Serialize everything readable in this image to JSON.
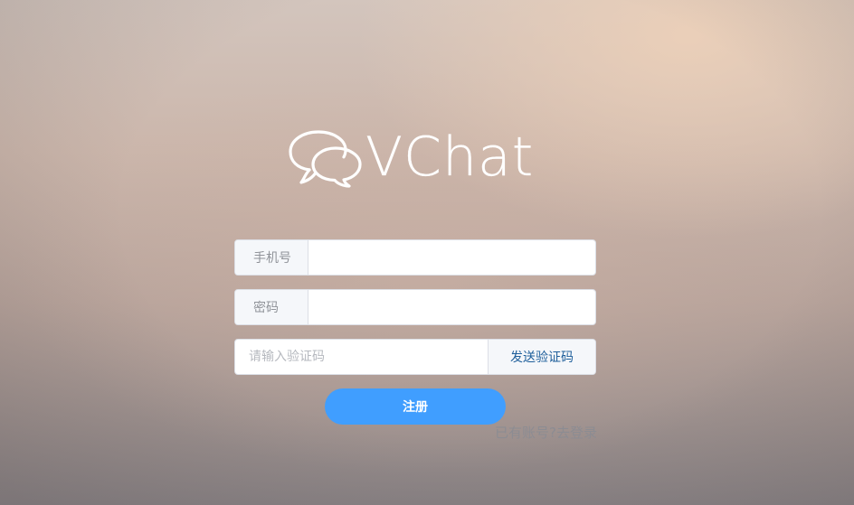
{
  "brand": {
    "logo_text": "VChat",
    "logo_icon": "chat-bubbles-icon"
  },
  "form": {
    "phone": {
      "label": "手机号",
      "value": "",
      "placeholder": ""
    },
    "password": {
      "label": "密码",
      "value": "",
      "placeholder": ""
    },
    "code": {
      "value": "",
      "placeholder": "请输入验证码",
      "send_label": "发送验证码"
    },
    "register_label": "注册",
    "login_link": "已有账号?去登录"
  },
  "colors": {
    "primary": "#409eff",
    "send_text": "#1f5f9b",
    "link_text": "#8c8c92"
  }
}
